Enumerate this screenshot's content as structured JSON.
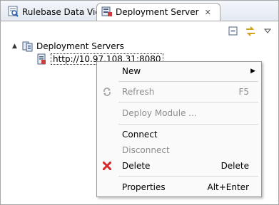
{
  "tabs": [
    {
      "label": "Rulebase Data View",
      "icon": "rulebase-view-icon",
      "active": false
    },
    {
      "label": "Deployment Server",
      "icon": "deployment-server-icon",
      "active": true,
      "close_icon": "close-icon"
    }
  ],
  "toolbar": {
    "collapse_icon": "collapse-all-icon",
    "link_icon": "link-with-editor-icon",
    "menu_icon": "view-menu-icon"
  },
  "tree": {
    "root": {
      "label": "Deployment Servers",
      "expanded": true
    },
    "child": {
      "label": "http://10.97.108.31:8080",
      "selected": true
    }
  },
  "context_menu": {
    "items": [
      {
        "label": "New",
        "accelerator": "",
        "enabled": true,
        "submenu": true
      },
      {
        "label": "Refresh",
        "accelerator": "F5",
        "enabled": false,
        "icon": "refresh-icon"
      },
      {
        "label": "Deploy Module ...",
        "accelerator": "",
        "enabled": false
      },
      {
        "label": "Connect",
        "accelerator": "",
        "enabled": true
      },
      {
        "label": "Disconnect",
        "accelerator": "",
        "enabled": false
      },
      {
        "label": "Delete",
        "accelerator": "Delete",
        "enabled": true,
        "icon": "delete-icon"
      },
      {
        "label": "Properties",
        "accelerator": "Alt+Enter",
        "enabled": true
      }
    ]
  },
  "colors": {
    "delete_icon": "#d42a2a",
    "selection_border": "#333333"
  }
}
